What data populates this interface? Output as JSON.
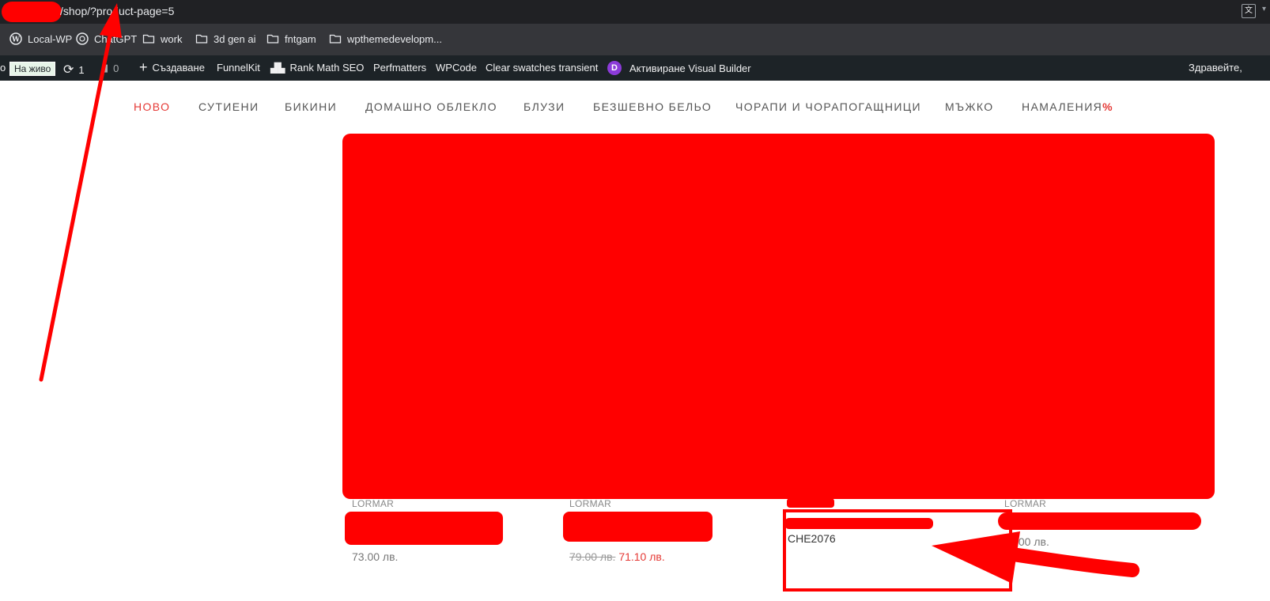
{
  "browser": {
    "url": "/shop/?product-page=5",
    "translate_icon": "translate-icon"
  },
  "bookmarks": [
    {
      "label": "Local-WP",
      "icon": "wordpress-icon"
    },
    {
      "label": "ChatGPT",
      "icon": "chatgpt-icon"
    },
    {
      "label": "work",
      "icon": "folder-icon"
    },
    {
      "label": "3d gen ai",
      "icon": "folder-icon"
    },
    {
      "label": "fntgam",
      "icon": "folder-icon"
    },
    {
      "label": "wpthemedevelopm...",
      "icon": "folder-icon"
    }
  ],
  "adminbar": {
    "site_fragment": "о",
    "live_label": "На живо",
    "updates_count": "1",
    "comments_count": "0",
    "new_label": "Създаване",
    "funnelkit": "FunnelKit",
    "rankmath": "Rank Math SEO",
    "perfmatters": "Perfmatters",
    "wpcode": "WPCode",
    "clear_swatches": "Clear swatches transient",
    "divi_logo_letter": "D",
    "visual_builder": "Активиране Visual Builder",
    "greeting": "Здравейте,"
  },
  "nav": {
    "items": [
      "НОВО",
      "СУТИЕНИ",
      "БИКИНИ",
      "ДОМАШНО ОБЛЕКЛО",
      "БЛУЗИ",
      "БЕЗШЕВНО БЕЛЬО",
      "ЧОРАПИ И ЧОРАПОГАЩНИЦИ",
      "МЪЖКО",
      "НАМАЛЕНИЯ"
    ],
    "sale_symbol": "%",
    "active_index": 0,
    "active_color": "#e53935"
  },
  "products": [
    {
      "brand": "LORMAR",
      "price": "73.00 лв."
    },
    {
      "brand": "LORMAR",
      "old_price": "79.00 лв.",
      "price": "71.10 лв."
    },
    {
      "sku": "CHE2076"
    },
    {
      "brand": "LORMAR",
      "price": ",00 лв."
    }
  ]
}
